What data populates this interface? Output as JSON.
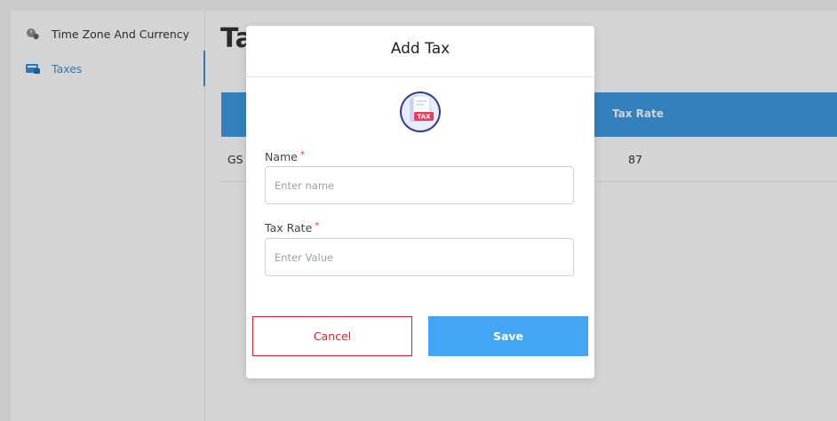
{
  "sidebar": {
    "items": [
      {
        "label": "Time Zone And Currency",
        "icon": "timezone-icon"
      },
      {
        "label": "Taxes",
        "icon": "taxes-icon",
        "active": true
      }
    ],
    "active_color": "#3b8ed8"
  },
  "main": {
    "title_visible": "Ta",
    "table": {
      "visible_header": "Tax Rate",
      "row": {
        "name_visible": "GS",
        "tax_rate": "87"
      }
    },
    "header_color": "#3d9be3"
  },
  "modal": {
    "title": "Add Tax",
    "icon": "tax-document-icon",
    "icon_badge": "TAX",
    "fields": {
      "name": {
        "label": "Name",
        "required_marker": "*",
        "placeholder": "Enter name",
        "value": ""
      },
      "tax_rate": {
        "label": "Tax Rate",
        "required_marker": "*",
        "placeholder": "Enter Value",
        "value": ""
      }
    },
    "buttons": {
      "cancel": "Cancel",
      "save": "Save"
    },
    "colors": {
      "cancel": "#dd2222",
      "save": "#42a5f5"
    }
  }
}
